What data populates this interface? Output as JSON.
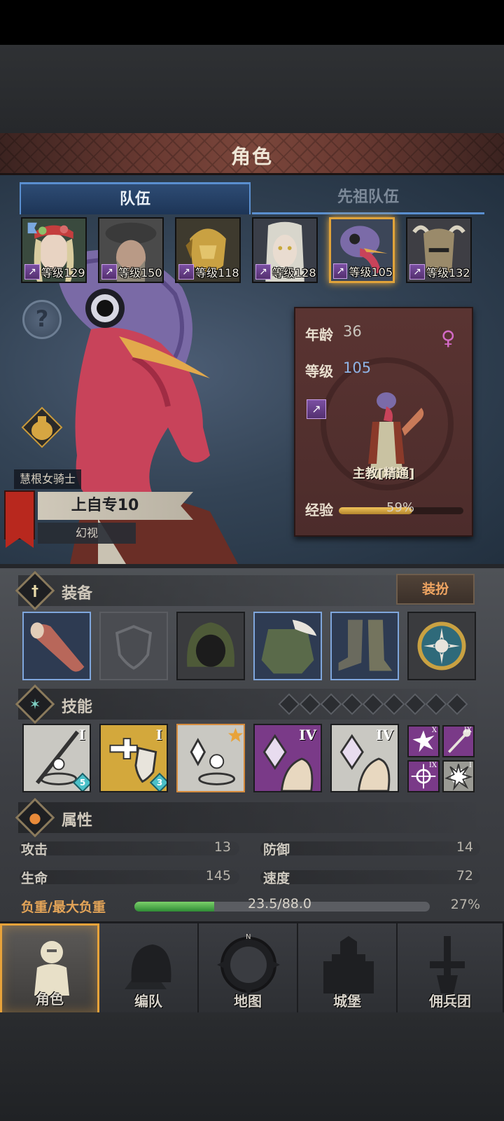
{
  "header": {
    "title": "角色"
  },
  "tabs": [
    {
      "label": "队伍",
      "active": true
    },
    {
      "label": "先祖队伍",
      "active": false
    }
  ],
  "roster": [
    {
      "level": "等级129",
      "portrait": "elf-flower-crown"
    },
    {
      "level": "等级150",
      "portrait": "bearded-hat-man"
    },
    {
      "level": "等级118",
      "portrait": "gold-helmet-elf"
    },
    {
      "level": "等级128",
      "portrait": "pale-elf"
    },
    {
      "level": "等级105",
      "portrait": "turkey-head",
      "selected": true
    },
    {
      "level": "等级132",
      "portrait": "horned-helmet"
    }
  ],
  "info": {
    "age_label": "年龄",
    "age_value": "36",
    "level_label": "等级",
    "level_value": "105",
    "class_name": "主教[精通]",
    "exp_label": "经验",
    "exp_percent": "59%",
    "exp_fraction": 0.59
  },
  "character": {
    "title": "慧根女骑士",
    "name": "上自专10",
    "subtitle": "幻视"
  },
  "equipment": {
    "section_title": "装备",
    "dress_button": "装扮",
    "slots": [
      "meat-club-weapon",
      "empty-shield",
      "green-hood",
      "fur-armor",
      "cloth-boots",
      "sun-amulet"
    ]
  },
  "skills": {
    "section_title": "技能",
    "gem_count": 9,
    "main": [
      {
        "icon": "spear-strike-skill",
        "tier": "I",
        "count": "5"
      },
      {
        "icon": "heal-shield-skill",
        "tier": "I",
        "count": "3"
      },
      {
        "icon": "crystal-heal-skill",
        "tier": ""
      },
      {
        "icon": "crystal-fist-skill",
        "tier": "IV"
      },
      {
        "icon": "crystal-fist-skill-2",
        "tier": "IV"
      }
    ],
    "mini": [
      {
        "icon": "burst-skill",
        "tier": "X"
      },
      {
        "icon": "staff-skill",
        "tier": "IX"
      },
      {
        "icon": "target-skill",
        "tier": "IX"
      },
      {
        "icon": "explosion-skill",
        "tier": "I"
      }
    ]
  },
  "attributes": {
    "section_title": "属性",
    "attack_label": "攻击",
    "attack_value": "13",
    "defense_label": "防御",
    "defense_value": "14",
    "hp_label": "生命",
    "hp_value": "145",
    "speed_label": "速度",
    "speed_value": "72",
    "load_label": "负重/最大负重",
    "load_value": "23.5/88.0",
    "load_percent": "27%",
    "load_fraction": 0.27
  },
  "nav": [
    {
      "label": "角色",
      "active": true
    },
    {
      "label": "编队",
      "active": false
    },
    {
      "label": "地图",
      "active": false
    },
    {
      "label": "城堡",
      "active": false
    },
    {
      "label": "佣兵团",
      "active": false
    }
  ],
  "colors": {
    "accent": "#e8a33a",
    "tab_active": "#2e4c74",
    "panel": "#5a3432",
    "exp": "#f0c35a",
    "load": "#7bd06a"
  }
}
